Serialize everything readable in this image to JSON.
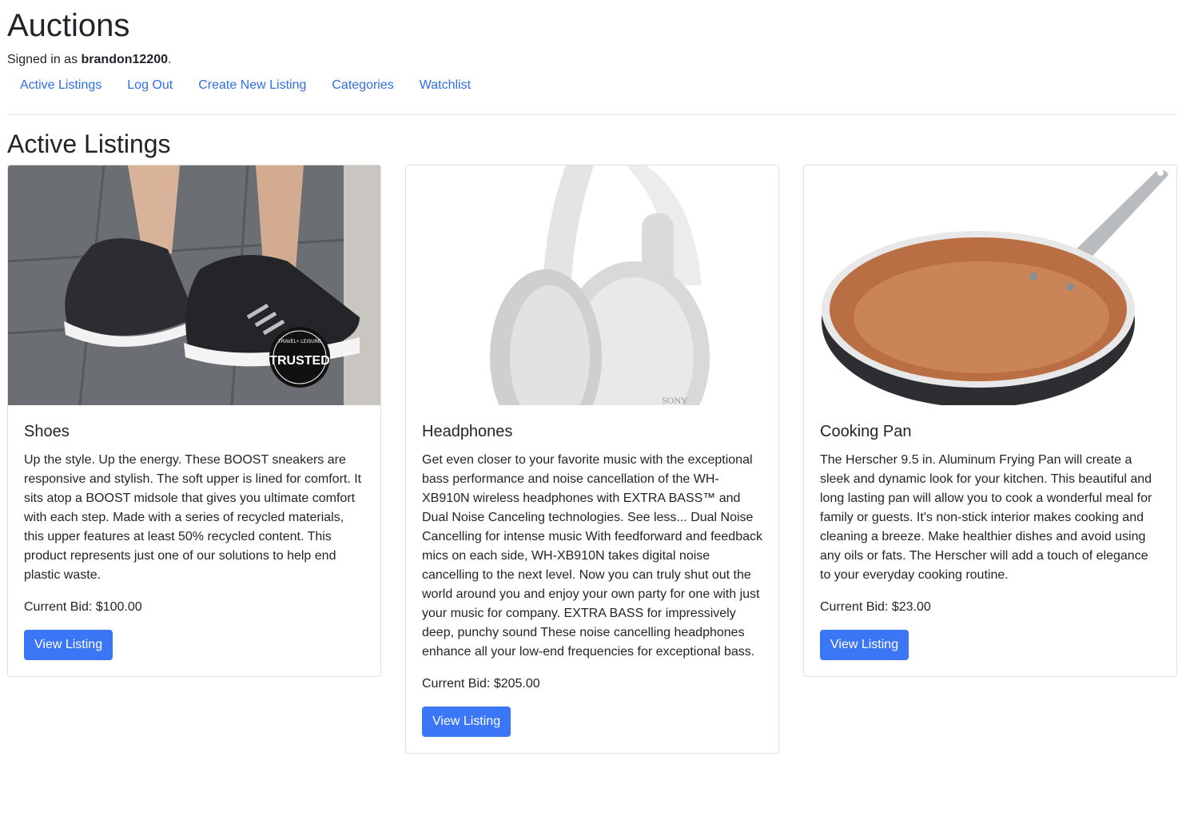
{
  "site": {
    "title": "Auctions",
    "signed_in_prefix": "Signed in as ",
    "username": "brandon12200",
    "signed_in_suffix": "."
  },
  "nav": [
    {
      "label": "Active Listings"
    },
    {
      "label": "Log Out"
    },
    {
      "label": "Create New Listing"
    },
    {
      "label": "Categories"
    },
    {
      "label": "Watchlist"
    }
  ],
  "heading": "Active Listings",
  "listings": [
    {
      "title": "Shoes",
      "description": "Up the style. Up the energy. These BOOST sneakers are responsive and stylish. The soft upper is lined for comfort. It sits atop a BOOST midsole that gives you ultimate comfort with each step. Made with a series of recycled materials, this upper features at least 50% recycled content. This product represents just one of our solutions to help end plastic waste.",
      "bid_label": "Current Bid: $100.00",
      "button": "View Listing",
      "badge_top": "TRAVEL+ LEISURE",
      "badge_main": "TRUSTED"
    },
    {
      "title": "Headphones",
      "description": "Get even closer to your favorite music with the exceptional bass performance and noise cancellation of the WH-XB910N wireless headphones with EXTRA BASS™ and Dual Noise Canceling technologies. See less... Dual Noise Cancelling for intense music With feedforward and feedback mics on each side, WH-XB910N takes digital noise cancelling to the next level. Now you can truly shut out the world around you and enjoy your own party for one with just your music for company. EXTRA BASS for impressively deep, punchy sound These noise cancelling headphones enhance all your low-end frequencies for exceptional bass.",
      "bid_label": "Current Bid: $205.00",
      "button": "View Listing",
      "brand_mark": "SONY"
    },
    {
      "title": "Cooking Pan",
      "description": "The Herscher 9.5 in. Aluminum Frying Pan will create a sleek and dynamic look for your kitchen. This beautiful and long lasting pan will allow you to cook a wonderful meal for family or guests. It's non-stick interior makes cooking and cleaning a breeze. Make healthier dishes and avoid using any oils or fats. The Herscher will add a touch of elegance to your everyday cooking routine.",
      "bid_label": "Current Bid: $23.00",
      "button": "View Listing"
    }
  ],
  "colors": {
    "link": "#2f6fe4",
    "button": "#3b76f6",
    "text": "#212529",
    "border": "#dfdfdf"
  }
}
